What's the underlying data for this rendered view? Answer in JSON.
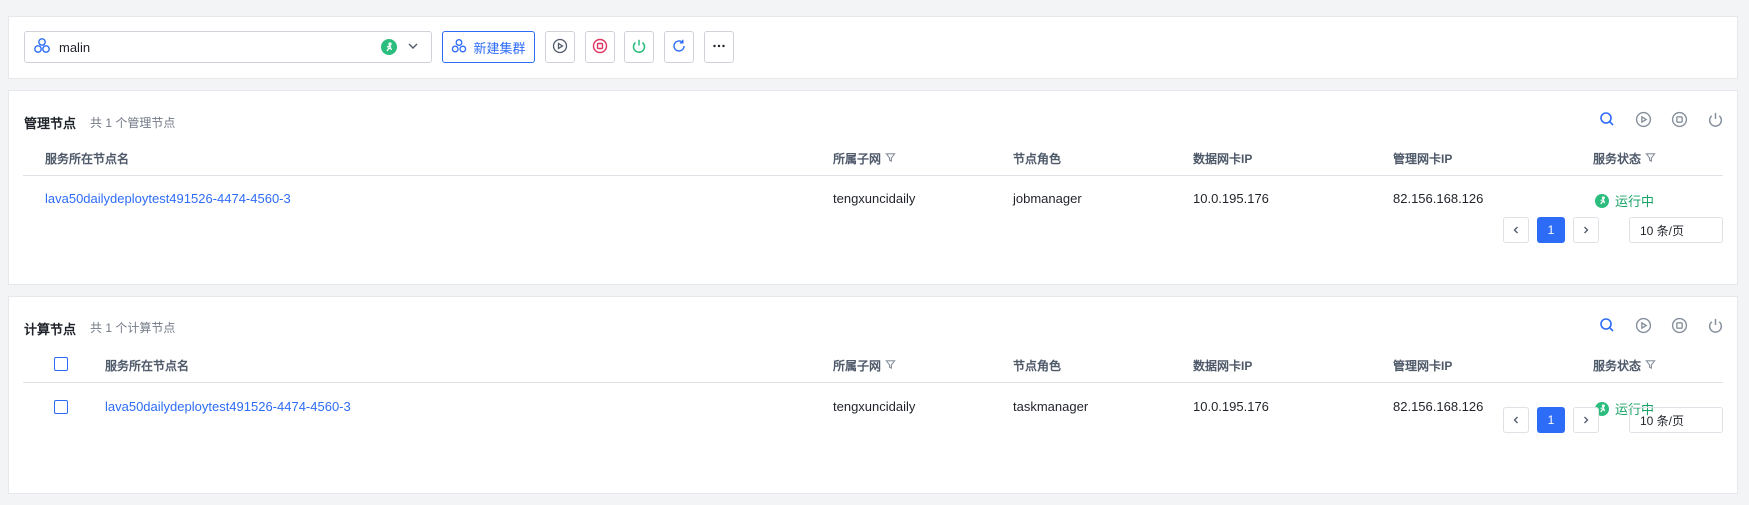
{
  "toolbar": {
    "cluster_name": "malin",
    "new_cluster_label": "新建集群",
    "colors": {
      "accent": "#2d6cf7",
      "running": "#2bbd7e",
      "stop": "#e0355f"
    }
  },
  "manager": {
    "title": "管理节点",
    "subtitle": "共 1 个管理节点",
    "columns": [
      "服务所在节点名",
      "所属子网",
      "节点角色",
      "数据网卡IP",
      "管理网卡IP",
      "服务状态"
    ],
    "rows": [
      {
        "node": "lava50dailydeploytest491526-4474-4560-3",
        "subnet": "tengxuncidaily",
        "role": "jobmanager",
        "data_ip": "10.0.195.176",
        "mgmt_ip": "82.156.168.126",
        "status": "运行中"
      }
    ],
    "pagination": {
      "current": "1",
      "page_size": "10 条/页"
    }
  },
  "compute": {
    "title": "计算节点",
    "subtitle": "共 1 个计算节点",
    "columns": [
      "服务所在节点名",
      "所属子网",
      "节点角色",
      "数据网卡IP",
      "管理网卡IP",
      "服务状态"
    ],
    "rows": [
      {
        "node": "lava50dailydeploytest491526-4474-4560-3",
        "subnet": "tengxuncidaily",
        "role": "taskmanager",
        "data_ip": "10.0.195.176",
        "mgmt_ip": "82.156.168.126",
        "status": "运行中"
      }
    ],
    "pagination": {
      "current": "1",
      "page_size": "10 条/页"
    }
  }
}
